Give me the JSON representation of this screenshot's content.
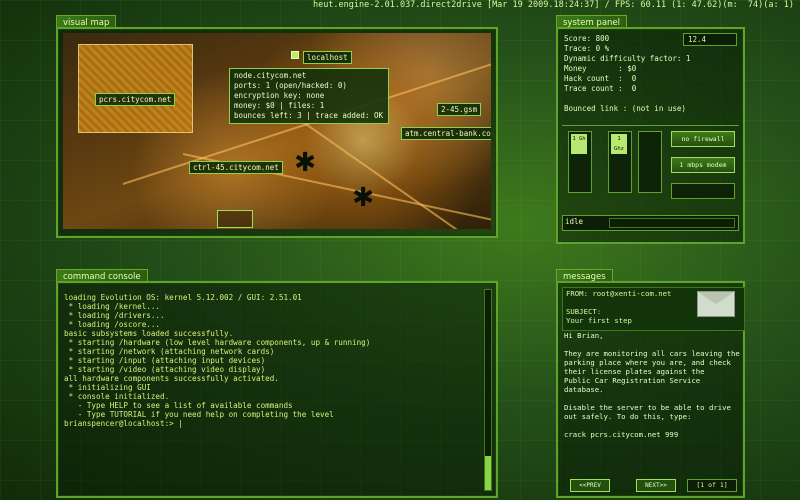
{
  "topbar": {
    "status": "heut.engine-2.01.037.direct2drive [Mar 19 2009.18:24:37] / FPS: 60.11 (1: 47.62)(m:  74)(a: 1)"
  },
  "visual_map": {
    "title": "visual map",
    "nodes": [
      {
        "label": "pcrs.citycom.net"
      },
      {
        "label": "localhost"
      },
      {
        "label": "2-45.gsm"
      },
      {
        "label": "atm.central-bank.com"
      },
      {
        "label": "ctrl-45.citycom.net"
      }
    ],
    "info": {
      "name": "node.citycom.net",
      "ports": "ports:  1 (open/hacked:  0)",
      "encryption": "encryption key:  none",
      "money_files": "money:  $0 | files: 1",
      "bounces": "bounces left: 3 | trace added: OK"
    }
  },
  "system_panel": {
    "title": "system panel",
    "lines": "Score: 800\nTrace: 0 %\nDynamic difficulty factor: 1\nMoney       : $0\nHack count  :  0\nTrace count :  0\n\nBounced link : (not in use)",
    "value_box": "12.4",
    "hardware": {
      "chip1": "1 Gh",
      "chip2": "1 Ghz",
      "firewall": "no firewall",
      "modem": "1 mbps modem"
    },
    "status": "idle"
  },
  "command_console": {
    "title": "command console",
    "lines": "loading Evolution OS: kernel 5.12.002 / GUI: 2.51.01\n * loading /kernel...\n * loading /drivers...\n * loading /oscore...\nbasic subsystems loaded successfully.\n * starting /hardware (low level hardware components, up & running)\n * starting /network (attaching network cards)\n * starting /input (attaching input devices)\n * starting /video (attaching video display)\nall hardware components successfully activated.\n * initializing GUI\n * console initialized.\n   - Type HELP to see a list of available commands\n   - Type TUTORIAL if you need help on completing the level\nbrianspencer@localhost:> |"
  },
  "messages": {
    "title": "messages",
    "from": "FROM: root@xenti-com.net",
    "subject_label": "SUBJECT:",
    "subject": "Your first step",
    "body": "Hi Brian,\n\nThey are monitoring all cars leaving the\nparking place where you are, and check\ntheir license plates against the\nPublic Car Registration Service\ndatabase.\n\nDisable the server to be able to drive\nout safely. To do this, type:\n\ncrack pcrs.citycom.net 999",
    "prev": "<<PREV",
    "next": "NEXT>>",
    "page": "[1 of 1]"
  }
}
